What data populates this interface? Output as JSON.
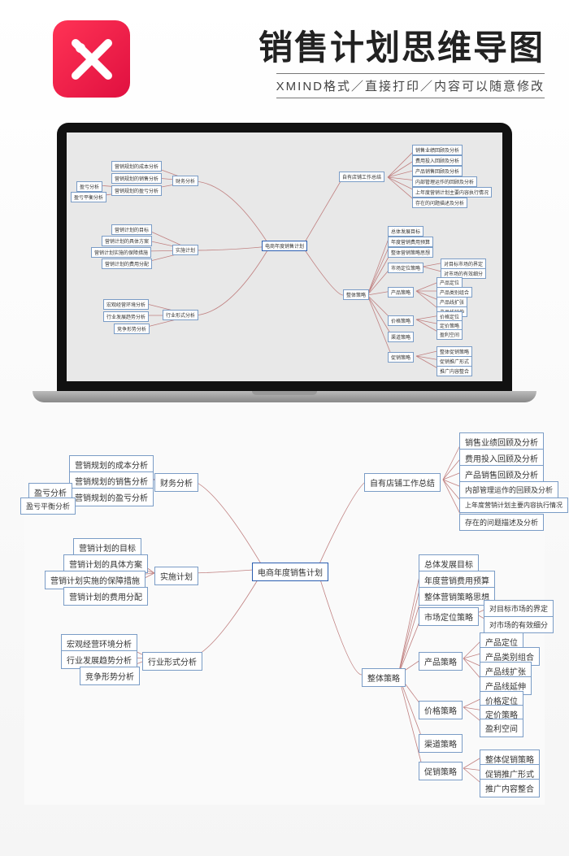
{
  "header": {
    "title": "销售计划思维导图",
    "subtitle": "XMIND格式／直接打印／内容可以随意修改",
    "logo_label": "XMind"
  },
  "mindmap": {
    "center": "电商年度销售计划",
    "left": [
      {
        "label": "财务分析",
        "children": [
          "营销规划的成本分析",
          "营销规划的销售分析",
          "营销规划的盈亏分析"
        ],
        "sub": [
          "盈亏分析",
          "盈亏平衡分析"
        ]
      },
      {
        "label": "实施计划",
        "children": [
          "营销计划的目标",
          "营销计划的具体方案",
          "营销计划实施的保障措施",
          "营销计划的费用分配"
        ]
      },
      {
        "label": "行业形式分析",
        "children": [
          "宏观经营环境分析",
          "行业发展趋势分析",
          "竞争形势分析"
        ]
      }
    ],
    "right": [
      {
        "label": "自有店铺工作总结",
        "children": [
          "销售业绩回顾及分析",
          "费用投入回顾及分析",
          "产品销售回顾及分析",
          "内部管理运作的回顾及分析",
          "上年度营销计划主要内容执行情况",
          "存在的问题描述及分析"
        ]
      },
      {
        "label": "整体策略",
        "children_plain": [
          "总体发展目标",
          "年度营销费用预算",
          "整体营销策略思想"
        ],
        "groups": [
          {
            "label": "市场定位策略",
            "items": [
              "对目标市场的界定",
              "对市场的有效细分"
            ]
          },
          {
            "label": "产品策略",
            "items": [
              "产品定位",
              "产品类别组合",
              "产品线扩张",
              "产品线延伸"
            ]
          },
          {
            "label": "价格策略",
            "items": [
              "价格定位",
              "定价策略",
              "盈利空间"
            ]
          },
          {
            "label": "渠道策略",
            "items": []
          },
          {
            "label": "促销策略",
            "items": [
              "整体促销策略",
              "促销推广形式",
              "推广内容整合"
            ]
          }
        ]
      }
    ]
  }
}
